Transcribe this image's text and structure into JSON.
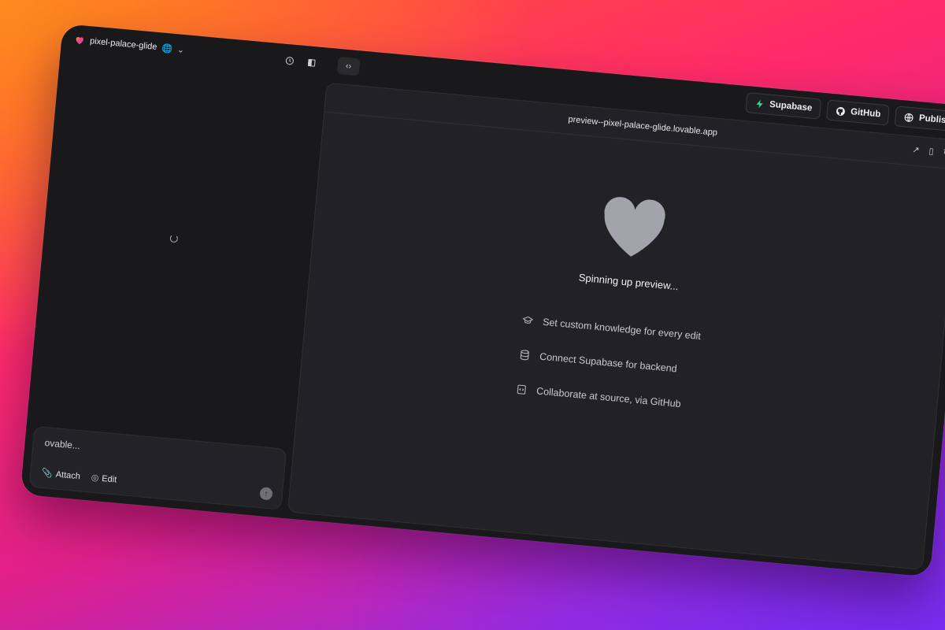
{
  "project": {
    "name": "pixel-palace-glide"
  },
  "actions": {
    "supabase": "Supabase",
    "github": "GitHub",
    "publish": "Publish"
  },
  "preview": {
    "url": "preview--pixel-palace-glide.lovable.app",
    "status": "Spinning up preview...",
    "tips": [
      {
        "icon": "graduation-cap-icon",
        "text": "Set custom knowledge for every edit"
      },
      {
        "icon": "database-icon",
        "text": "Connect Supabase for backend"
      },
      {
        "icon": "code-file-icon",
        "text": "Collaborate at source, via GitHub"
      }
    ]
  },
  "composer": {
    "placeholder": "ovable...",
    "attach": "Attach",
    "edit": "Edit"
  },
  "colors": {
    "heart": "#a3a3ab",
    "supabase": "#3ecf8e"
  }
}
